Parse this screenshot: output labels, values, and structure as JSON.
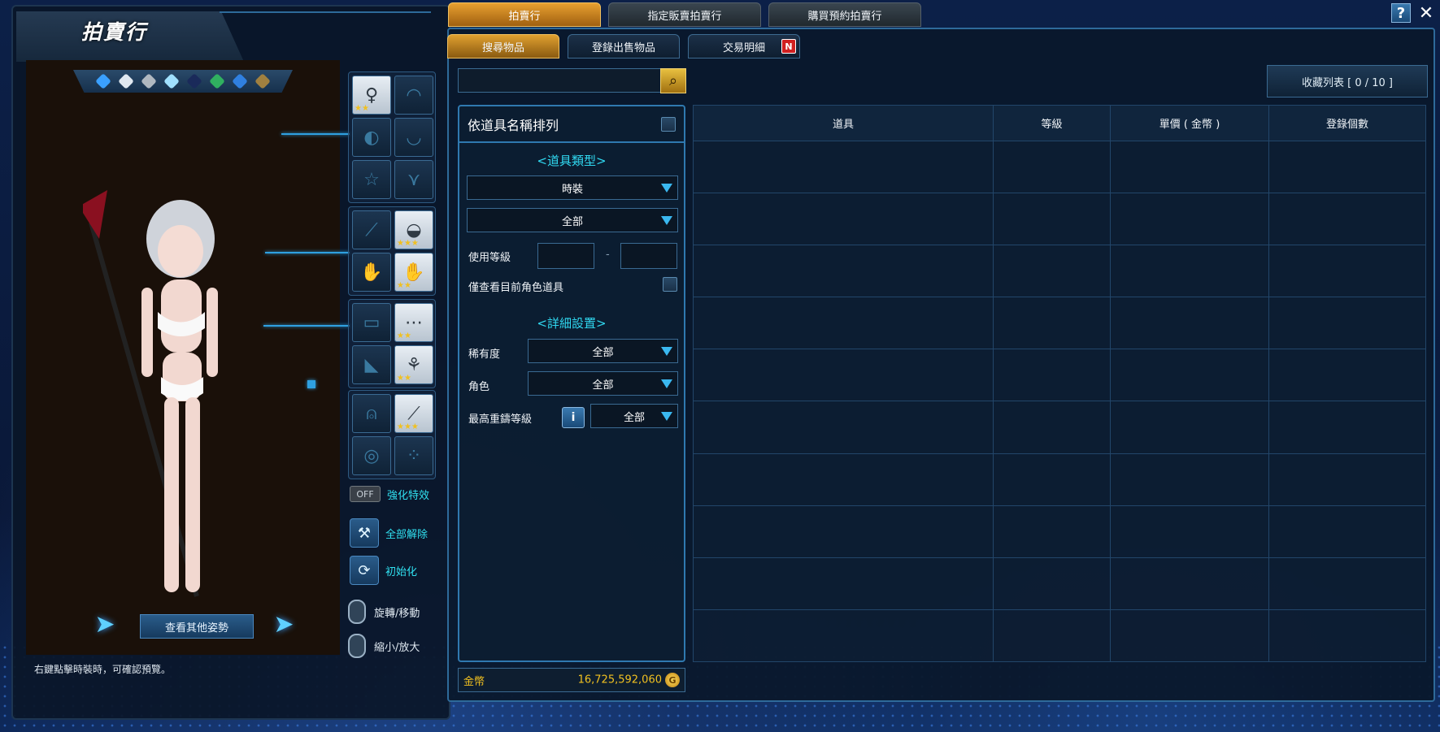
{
  "left": {
    "title": "拍賣行",
    "pose_button": "查看其他姿勢",
    "hint": "右鍵點擊時裝時，可確認預覽。",
    "off_label": "OFF",
    "enhance_label": "強化特效",
    "unequip_all_label": "全部解除",
    "reset_label": "初始化",
    "rotate_label": "旋轉/移動",
    "zoom_label": "縮小/放大",
    "tier_colors": [
      "#3aa0ff",
      "#e0e8f0",
      "#b0b8c0",
      "#a0e0ff",
      "#1a2a5a",
      "#30b060",
      "#3080e0",
      "#a08040"
    ]
  },
  "tabs": {
    "main": [
      "拍賣行",
      "指定販賣拍賣行",
      "購買預約拍賣行"
    ],
    "sub": [
      "搜尋物品",
      "登錄出售物品",
      "交易明細"
    ],
    "new_badge": "N"
  },
  "search": {
    "placeholder": "",
    "wishlist_label": "收藏列表 [ 0 / 10 ]"
  },
  "filters": {
    "sort_label": "依道具名稱排列",
    "item_type_title": "<道具類型>",
    "item_type_value": "時裝",
    "item_subtype_value": "全部",
    "level_label": "使用等級",
    "level_dash": "-",
    "current_char_label": "僅查看目前角色道具",
    "detail_title": "<詳細設置>",
    "rarity_label": "稀有度",
    "rarity_value": "全部",
    "character_label": "角色",
    "character_value": "全部",
    "max_refine_label": "最高重鑄等級",
    "max_refine_value": "全部"
  },
  "gold": {
    "label": "金幣",
    "value": "16,725,592,060",
    "coin_symbol": "G"
  },
  "table": {
    "headers": [
      "道具",
      "等級",
      "單價 ( 金幣 )",
      "登錄個數"
    ],
    "row_count": 10
  }
}
